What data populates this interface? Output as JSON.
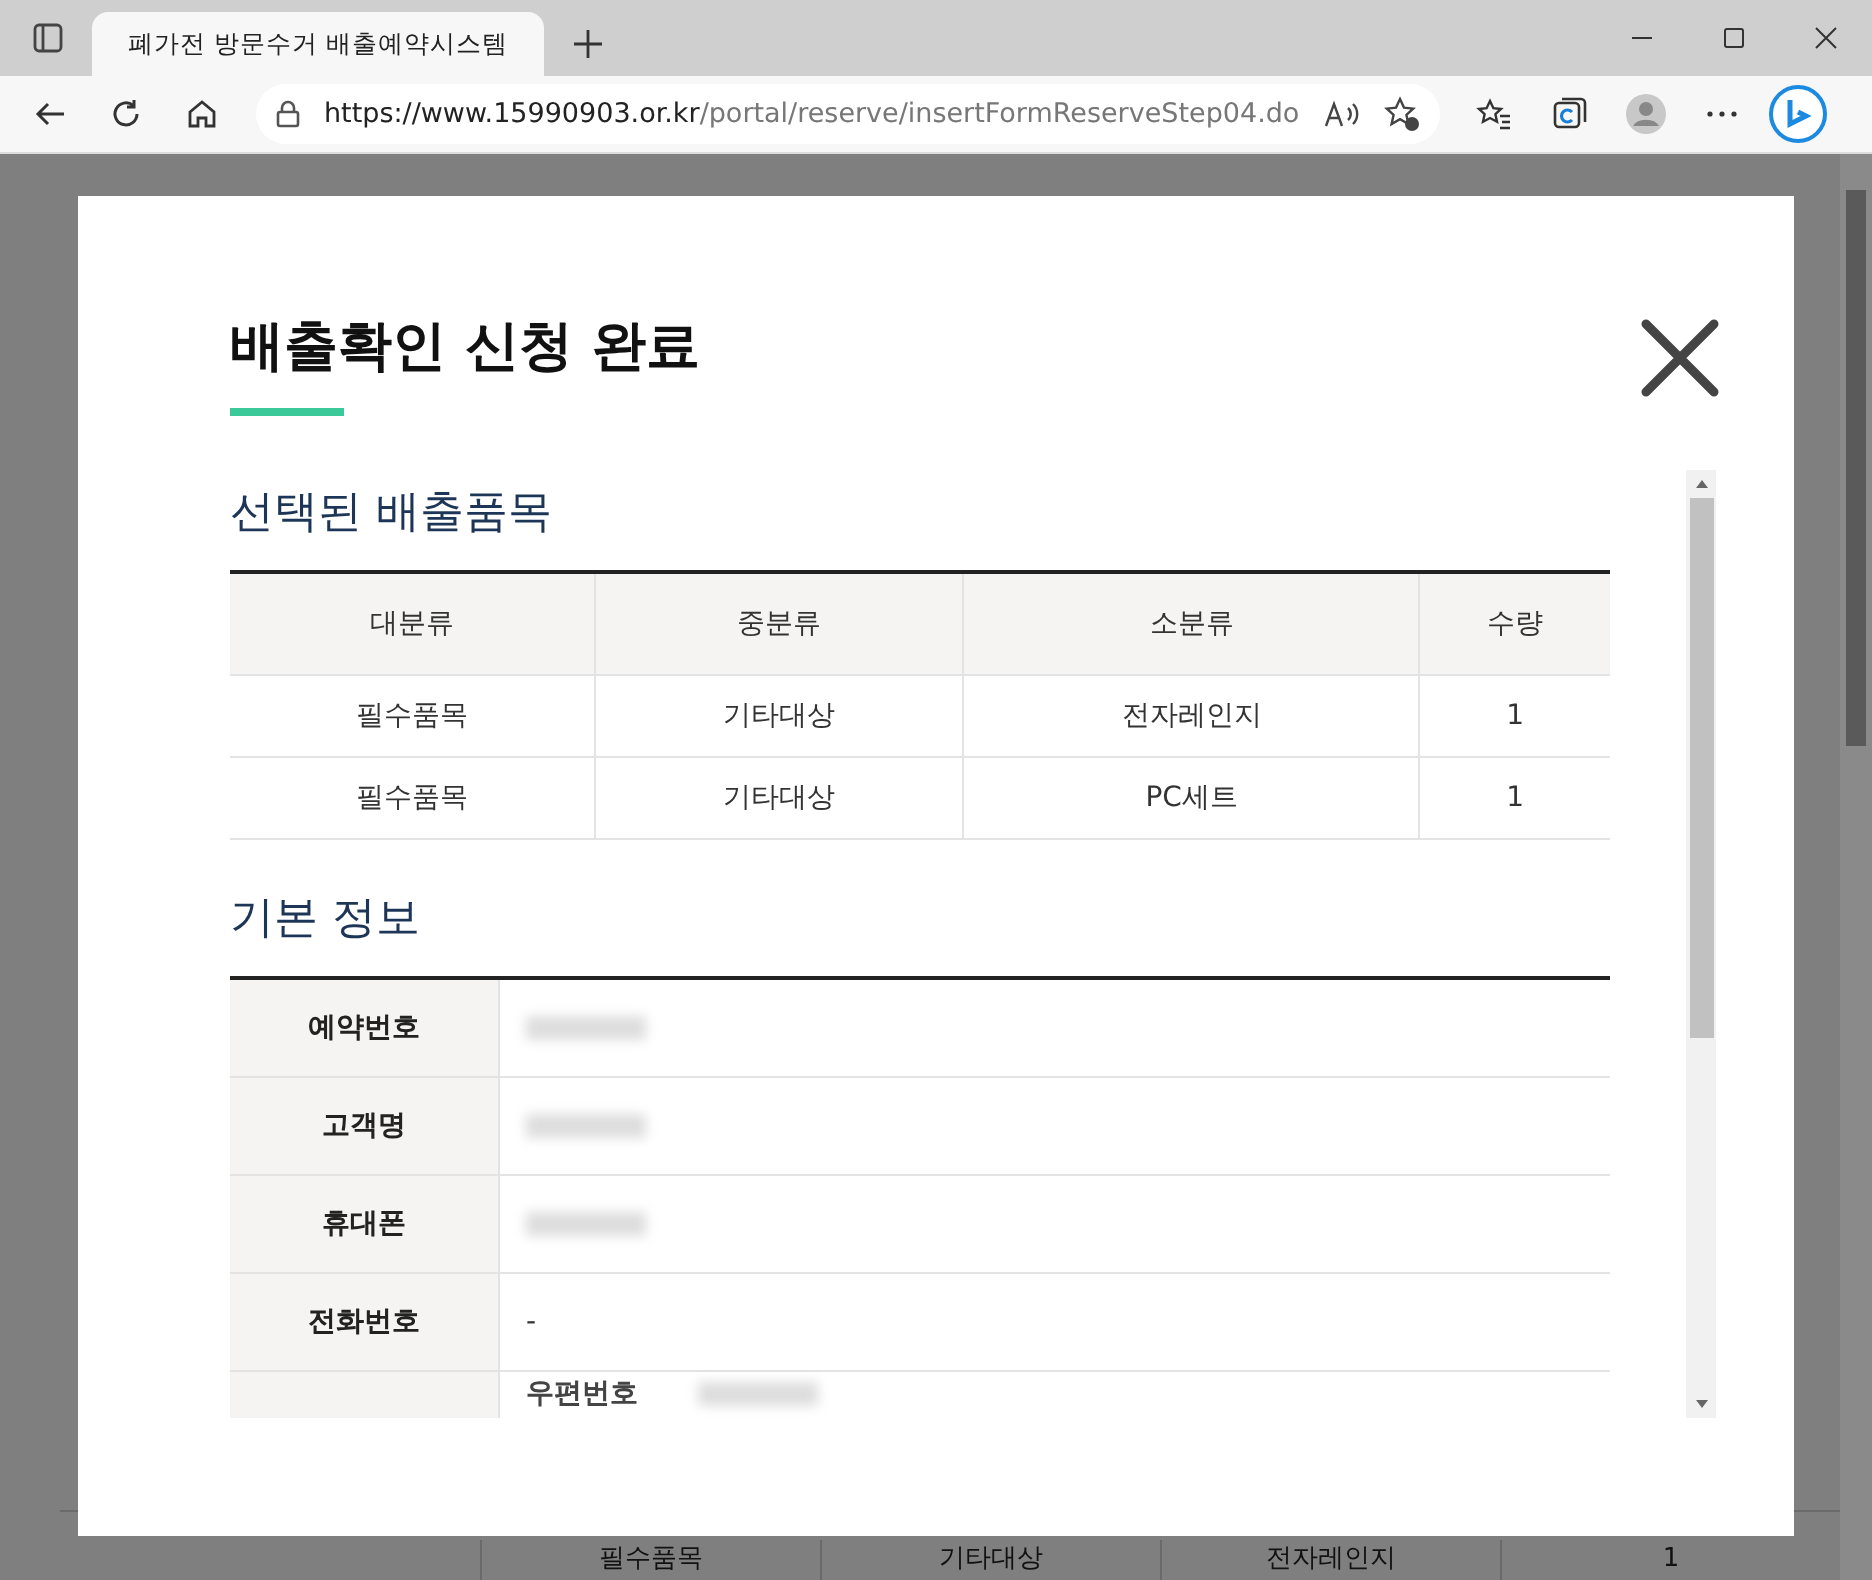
{
  "browser": {
    "tab_title": "폐가전 방문수거 배출예약시스템",
    "url_host": "https://www.15990903.or.kr",
    "url_path": "/portal/reserve/insertFormReserveStep04.do"
  },
  "background_row": [
    "필수품목",
    "기타대상",
    "전자레인지",
    "1"
  ],
  "modal": {
    "title": "배출확인 신청 완료",
    "items_heading": "선택된 배출품목",
    "items_columns": [
      "대분류",
      "중분류",
      "소분류",
      "수량"
    ],
    "items_rows": [
      [
        "필수품목",
        "기타대상",
        "전자레인지",
        "1"
      ],
      [
        "필수품목",
        "기타대상",
        "PC세트",
        "1"
      ]
    ],
    "info_heading": "기본 정보",
    "info_rows": [
      {
        "label": "예약번호",
        "kind": "redacted"
      },
      {
        "label": "고객명",
        "kind": "redacted"
      },
      {
        "label": "휴대폰",
        "kind": "redacted"
      },
      {
        "label": "전화번호",
        "kind": "text",
        "value": "-"
      },
      {
        "label": "우편번호",
        "kind": "sublabel"
      }
    ]
  }
}
